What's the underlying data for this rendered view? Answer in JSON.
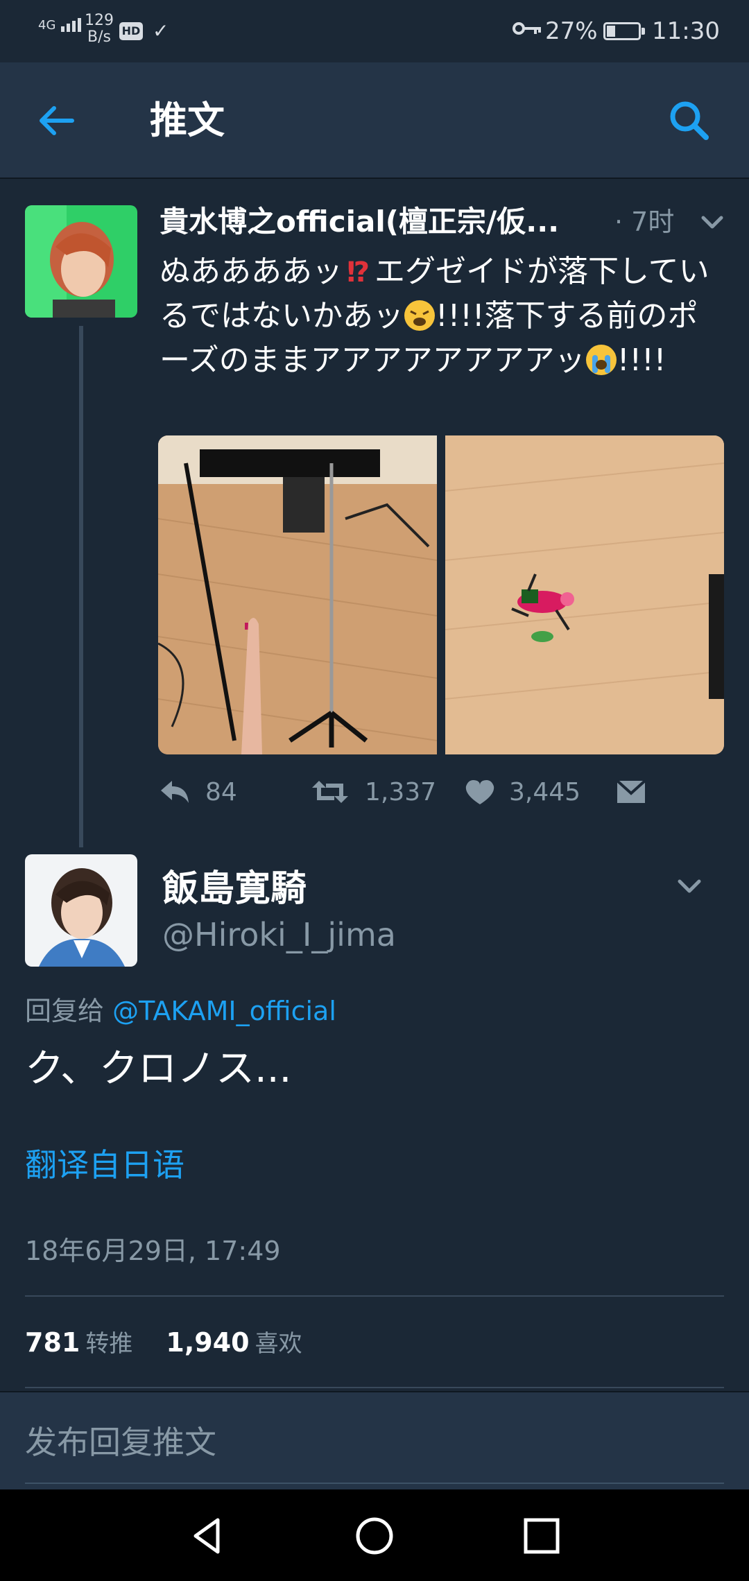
{
  "status_bar": {
    "network": "4G",
    "net_rate_value": "129",
    "net_rate_unit": "B/s",
    "hd_badge": "HD",
    "battery_percent": "27%",
    "battery_level": 0.27,
    "time": "11:30"
  },
  "header": {
    "title": "推文"
  },
  "colors": {
    "background": "#1b2836",
    "header": "#243447",
    "accent": "#1da1f2",
    "secondary_text": "#8899a6"
  },
  "tweet1": {
    "author_name": "貴水博之official(檀正宗/仮...",
    "time": "· 7时",
    "text_part1": "ぬああああッ",
    "emoji1": "interrobang-emoji",
    "text_part2": "エグゼイドが落下しているではないかあッ",
    "emoji2": "weary-face-emoji",
    "text_part3": "!!!!落下する前のポーズのままアアアアアアアアッ",
    "emoji3": "crying-face-emoji",
    "text_part4": "!!!!",
    "actions": {
      "reply_count": "84",
      "retweet_count": "1,337",
      "like_count": "3,445"
    }
  },
  "tweet2": {
    "author_name": "飯島寛騎",
    "handle": "@Hiroki_I_jima",
    "reply_prefix": "回复给",
    "reply_mention": "@TAKAMI_official",
    "text": "ク、クロノス...",
    "translate_label": "翻译自日语",
    "timestamp": "18年6月29日, 17:49",
    "retweets_value": "781",
    "retweets_label": "转推",
    "likes_value": "1,940",
    "likes_label": "喜欢"
  },
  "compose": {
    "placeholder": "发布回复推文"
  }
}
